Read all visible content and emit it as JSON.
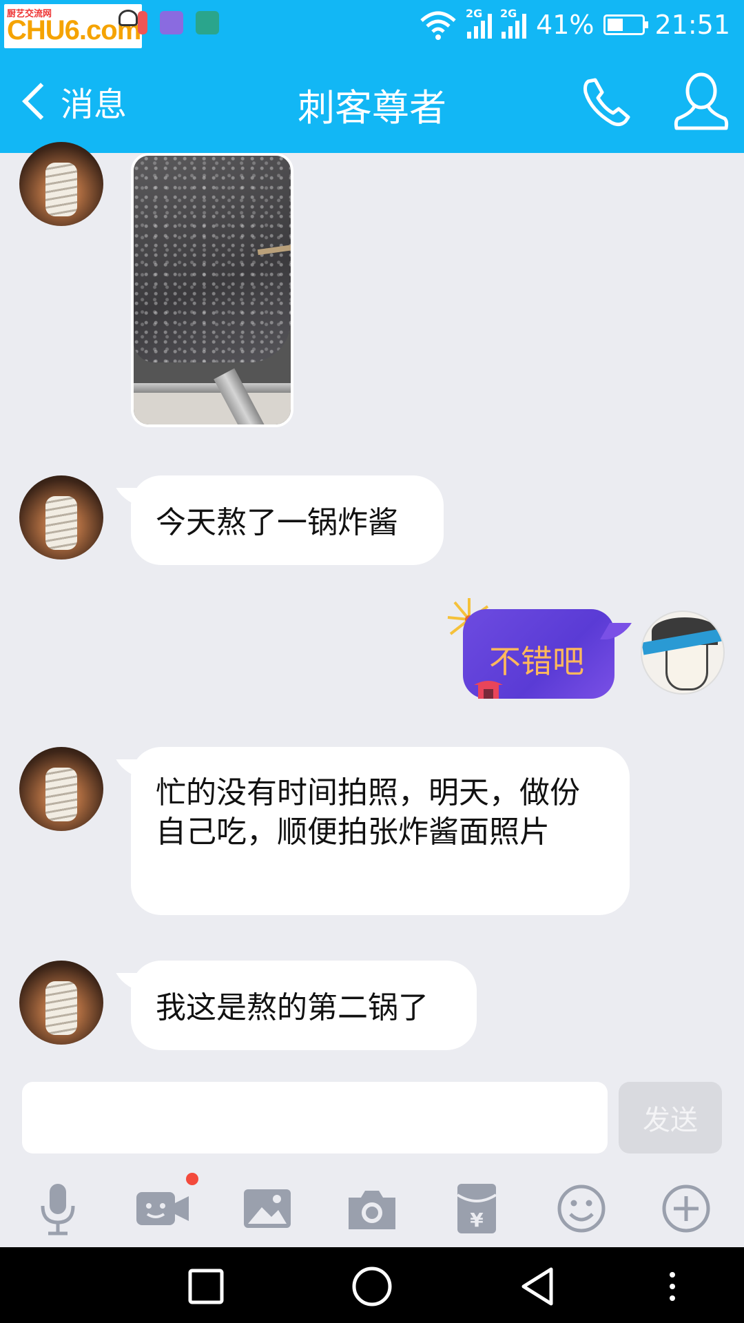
{
  "status_bar": {
    "watermark_small": "厨艺交流网",
    "watermark_logo": "CHU6.com",
    "network_1": "2G",
    "network_2": "2G",
    "battery": "41%",
    "time": "21:51"
  },
  "header": {
    "back_label": "消息",
    "title": "刺客尊者"
  },
  "messages": [
    {
      "from": "friend",
      "type": "image"
    },
    {
      "from": "friend",
      "type": "text",
      "text": "今天熬了一锅炸酱"
    },
    {
      "from": "self",
      "type": "text",
      "text": "不错吧"
    },
    {
      "from": "friend",
      "type": "text",
      "text": "忙的没有时间拍照，明天，做份自己吃，顺便拍张炸酱面照片"
    },
    {
      "from": "friend",
      "type": "text",
      "text": "我这是熬的第二锅了"
    }
  ],
  "composer": {
    "input_value": "",
    "send_label": "发送"
  },
  "toolbar": {
    "items": [
      "mic-icon",
      "video-icon",
      "image-icon",
      "camera-icon",
      "red-packet-icon",
      "emoji-icon",
      "plus-icon"
    ],
    "red_packet_symbol": "¥"
  },
  "colors": {
    "accent": "#12b7f5",
    "background": "#ebecf1",
    "bubble": "#ffffff",
    "self_bubble": "#5a3bd5",
    "self_text": "#ffb85c",
    "badge": "#f34a3c"
  }
}
